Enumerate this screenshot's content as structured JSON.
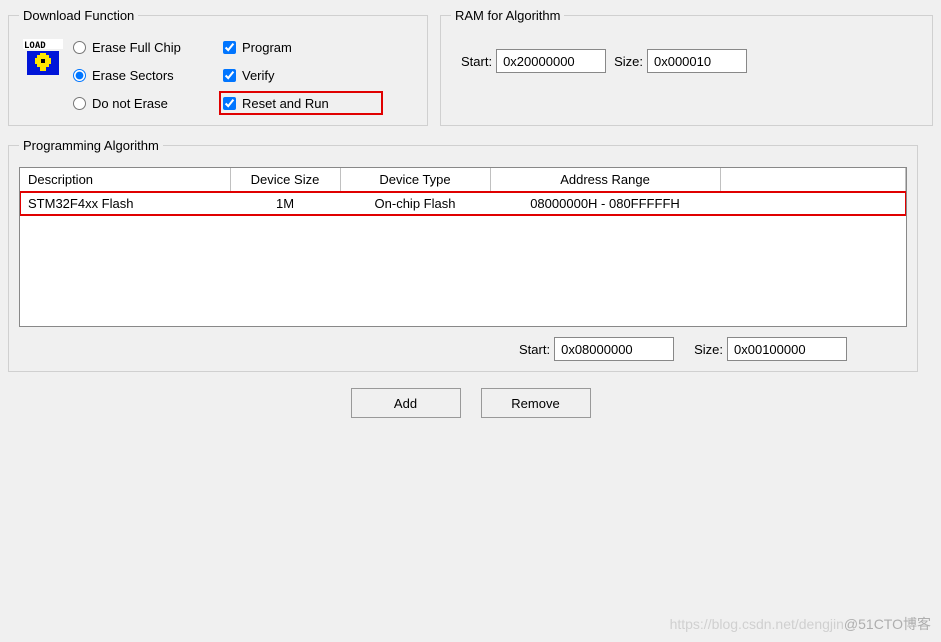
{
  "downloadFunction": {
    "legend": "Download Function",
    "eraseFullChip": "Erase Full Chip",
    "eraseSectors": "Erase Sectors",
    "doNotErase": "Do not Erase",
    "program": "Program",
    "verify": "Verify",
    "resetAndRun": "Reset and Run",
    "loadIconLabel": "LOAD"
  },
  "ramAlgo": {
    "legend": "RAM for Algorithm",
    "startLabel": "Start:",
    "startValue": "0x20000000",
    "sizeLabel": "Size:",
    "sizeValue": "0x000010"
  },
  "progAlgo": {
    "legend": "Programming Algorithm",
    "columns": {
      "description": "Description",
      "deviceSize": "Device Size",
      "deviceType": "Device Type",
      "addressRange": "Address Range"
    },
    "rows": [
      {
        "description": "STM32F4xx Flash",
        "deviceSize": "1M",
        "deviceType": "On-chip Flash",
        "addressRange": "08000000H - 080FFFFFH"
      }
    ],
    "startLabel": "Start:",
    "startValue": "0x08000000",
    "sizeLabel": "Size:",
    "sizeValue": "0x00100000"
  },
  "buttons": {
    "add": "Add",
    "remove": "Remove"
  },
  "watermark": {
    "faint": "https://blog.csdn.net/dengjin",
    "text": "@51CTO博客"
  }
}
